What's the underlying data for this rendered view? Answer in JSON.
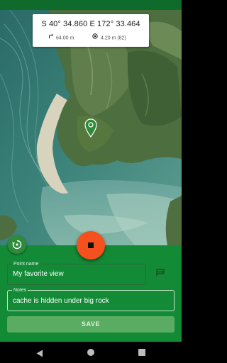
{
  "coordinates": {
    "position": "S 40° 34.860  E 172° 33.464",
    "altitude": "64.00 m",
    "accuracy": "4.20 m (82)"
  },
  "icons": {
    "altitude": "altitude-arrow-icon",
    "accuracy": "gps-target-icon",
    "pin": "map-pin-icon",
    "undo": "undo-location-icon",
    "record": "stop-icon",
    "note": "comment-icon",
    "nav": [
      "back-icon",
      "home-icon",
      "recents-icon"
    ]
  },
  "form": {
    "point_name_label": "Point name",
    "point_name_value": "My favorite view",
    "notes_label": "Notes",
    "notes_value": "cache is hidden under big rock",
    "save_label": "SAVE"
  },
  "colors": {
    "status_bar": "#0e6b2c",
    "panel": "#138a36",
    "record_button": "#f4511e",
    "save_button": "#5aac63",
    "pin": "#2e8b3a"
  }
}
